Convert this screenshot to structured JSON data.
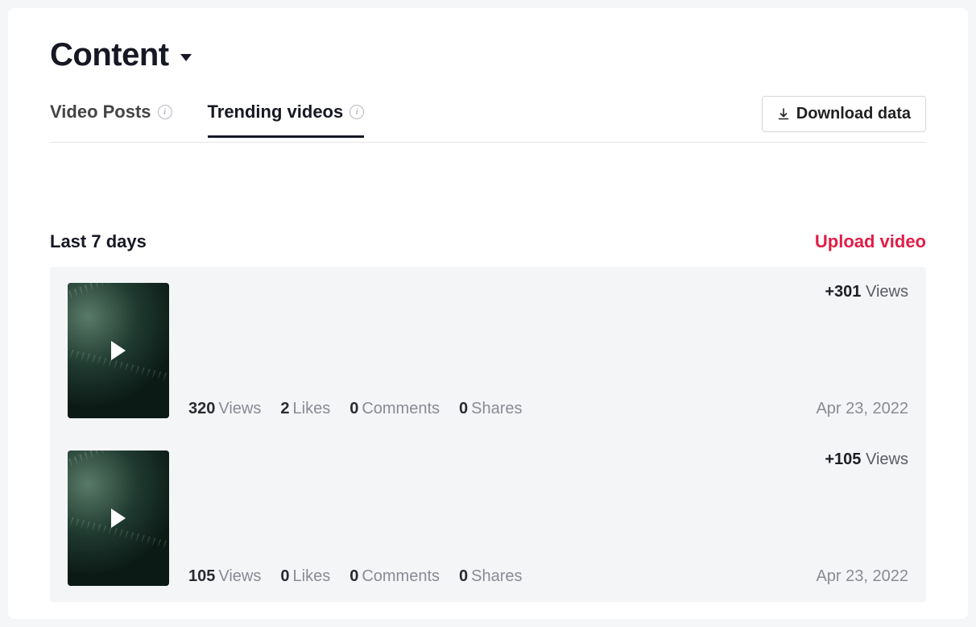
{
  "header": {
    "title": "Content"
  },
  "tabs": {
    "video_posts": "Video Posts",
    "trending": "Trending videos"
  },
  "download_label": "Download data",
  "section": {
    "title": "Last 7 days",
    "upload": "Upload video"
  },
  "labels": {
    "views": "Views",
    "likes": "Likes",
    "comments": "Comments",
    "shares": "Shares"
  },
  "videos": [
    {
      "views": "320",
      "likes": "2",
      "comments": "0",
      "shares": "0",
      "delta": "+301",
      "date": "Apr 23, 2022"
    },
    {
      "views": "105",
      "likes": "0",
      "comments": "0",
      "shares": "0",
      "delta": "+105",
      "date": "Apr 23, 2022"
    }
  ]
}
